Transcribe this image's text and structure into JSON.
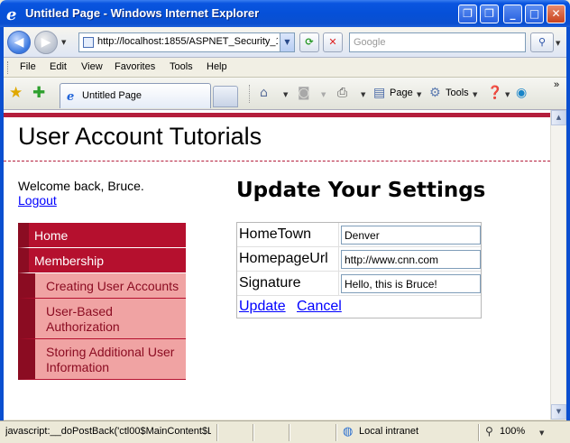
{
  "window": {
    "title": "Untitled Page - Windows Internet Explorer",
    "minimize_glyph": "_",
    "maximize_glyph": "□",
    "close_glyph": "✕",
    "restore_glyph": "❐"
  },
  "addressbar": {
    "url": "http://localhost:1855/ASPNET_Security_1",
    "search_placeholder": "Google"
  },
  "menu": {
    "items": [
      "File",
      "Edit",
      "View",
      "Favorites",
      "Tools",
      "Help"
    ]
  },
  "tabs": {
    "active_label": "Untitled Page"
  },
  "toolbar": {
    "page_label": "Page",
    "tools_label": "Tools",
    "overflow": "»"
  },
  "site": {
    "title": "User Account Tutorials",
    "welcome": "Welcome back, Bruce.",
    "logout": "Logout",
    "accent_color": "#b5102e",
    "nav": {
      "home": "Home",
      "membership": "Membership",
      "sub_items": [
        "Creating User Accounts",
        "User-Based Authorization",
        "Storing Additional User Information"
      ]
    }
  },
  "form": {
    "heading": "Update Your Settings",
    "fields": [
      {
        "label": "HomeTown",
        "value": "Denver"
      },
      {
        "label": "HomepageUrl",
        "value": "http://www.cnn.com"
      },
      {
        "label": "Signature",
        "value": "Hello, this is Bruce!"
      }
    ],
    "update_link": "Update",
    "cancel_link": "Cancel"
  },
  "statusbar": {
    "text": "javascript:__doPostBack('ctl00$MainContent$L",
    "zone": "Local intranet",
    "zoom": "100%"
  }
}
